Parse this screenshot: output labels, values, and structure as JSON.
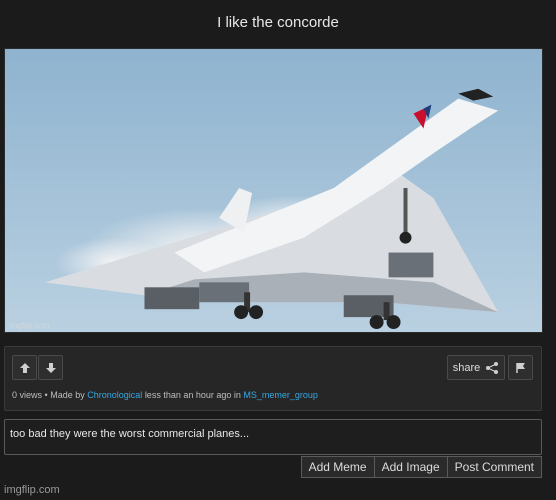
{
  "post": {
    "title": "I like the concorde",
    "image_watermark": "imgflip.com",
    "image_subject": "Concorde airliner in flight, British Airways livery"
  },
  "stats": {
    "views": "0 views",
    "separator": "•",
    "made_by_prefix": "Made by",
    "author": "Chronological",
    "time_text": "less than an hour ago in",
    "stream": "MS_memer_group"
  },
  "actions": {
    "upvote_icon": "arrow-up-icon",
    "downvote_icon": "arrow-down-icon",
    "share_label": "share",
    "share_icon": "share-icon",
    "flag_icon": "flag-icon"
  },
  "comment": {
    "value": "too bad they were the worst commercial planes..."
  },
  "comment_actions": {
    "add_meme": "Add Meme",
    "add_image": "Add Image",
    "post_comment": "Post Comment"
  },
  "footer": {
    "logo": "imgflip.com"
  },
  "colors": {
    "background": "#1b1b1b",
    "link": "#37a7e4"
  }
}
